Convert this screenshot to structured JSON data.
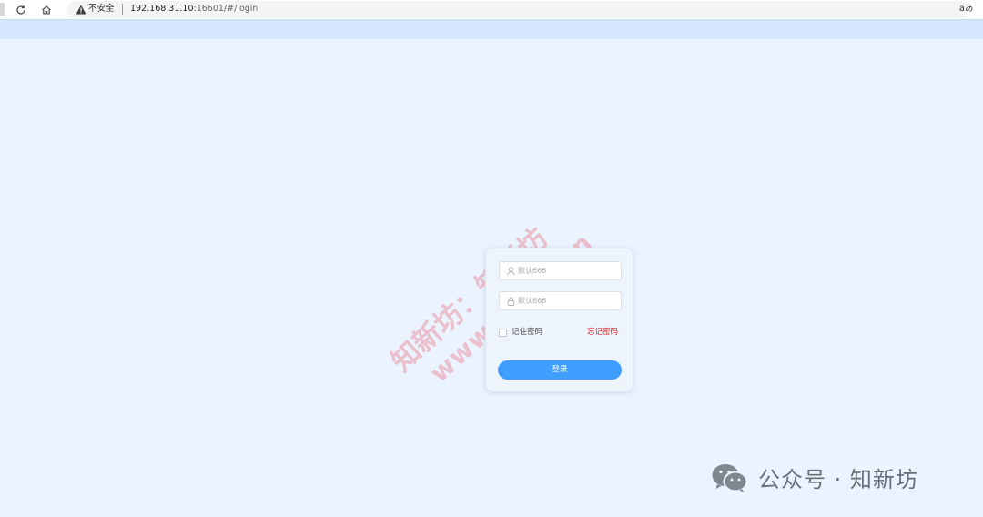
{
  "browser": {
    "security_label": "不安全",
    "url_host": "192.168.31.10",
    "url_path": ":16601/#/login",
    "reader_label": "aあ"
  },
  "login": {
    "username_placeholder": "默认666",
    "password_placeholder": "默认666",
    "remember_label": "记住密码",
    "forgot_label": "忘记密码",
    "submit_label": "登录"
  },
  "watermark": {
    "line1": "知新坊：知新坊",
    "line2": "www.xuxlc.cn"
  },
  "footer": {
    "brand": "公众号 · 知新坊"
  },
  "colors": {
    "primary": "#409eff",
    "danger": "#e02020",
    "page_bg": "#ebf3fe"
  }
}
